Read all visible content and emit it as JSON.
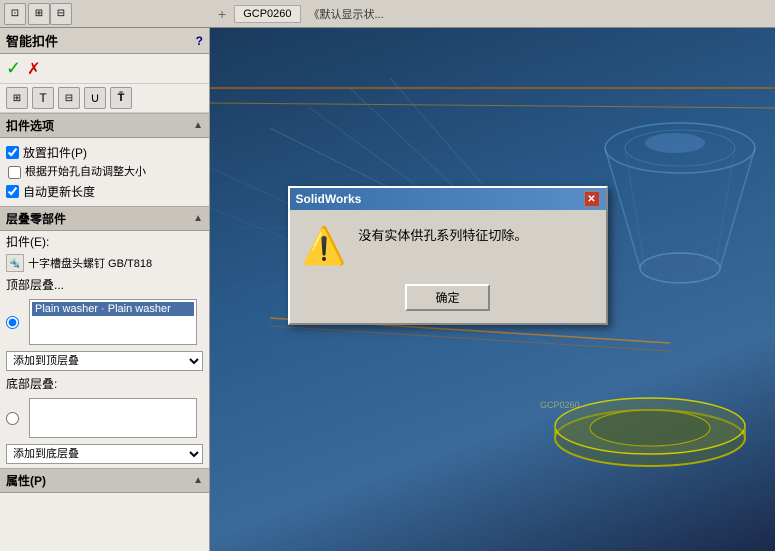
{
  "toolbar": {
    "title": "智能扣件",
    "help_label": "?",
    "confirm_label": "✓",
    "cancel_label": "✗"
  },
  "icon_buttons": [
    {
      "name": "icon-btn-1",
      "label": "⊞"
    },
    {
      "name": "icon-btn-2",
      "label": "T"
    },
    {
      "name": "icon-btn-3",
      "label": "⊟"
    },
    {
      "name": "icon-btn-4",
      "label": "∪"
    },
    {
      "name": "icon-btn-5",
      "label": "T"
    }
  ],
  "fastener_options": {
    "section_label": "扣件选项",
    "place_fastener_label": "放置扣件(P)",
    "place_fastener_checked": true,
    "auto_adjust_label": "根据开始孔自动调整大小",
    "auto_adjust_checked": false,
    "auto_update_label": "自动更新长度",
    "auto_update_checked": true
  },
  "stack_section": {
    "section_label": "层叠零部件",
    "fastener_label": "扣件(E):",
    "fastener_value": "十字槽盘头螺钉 GB/T818",
    "top_stack_label": "顶部层叠...",
    "stack_item": "Plain washer · Plain washer",
    "add_top_label": "添加到顶层叠",
    "bottom_stack_label": "底部层叠:",
    "add_bottom_label": "添加到底层叠"
  },
  "properties_section": {
    "label": "属性(P)"
  },
  "viewport": {
    "gcp_label": "GCP0260",
    "status_label": "《默认显示状..."
  },
  "dialog": {
    "title": "SolidWorks",
    "message": "没有实体供孔系列特征切除。",
    "ok_label": "确定",
    "icon": "⚠"
  }
}
